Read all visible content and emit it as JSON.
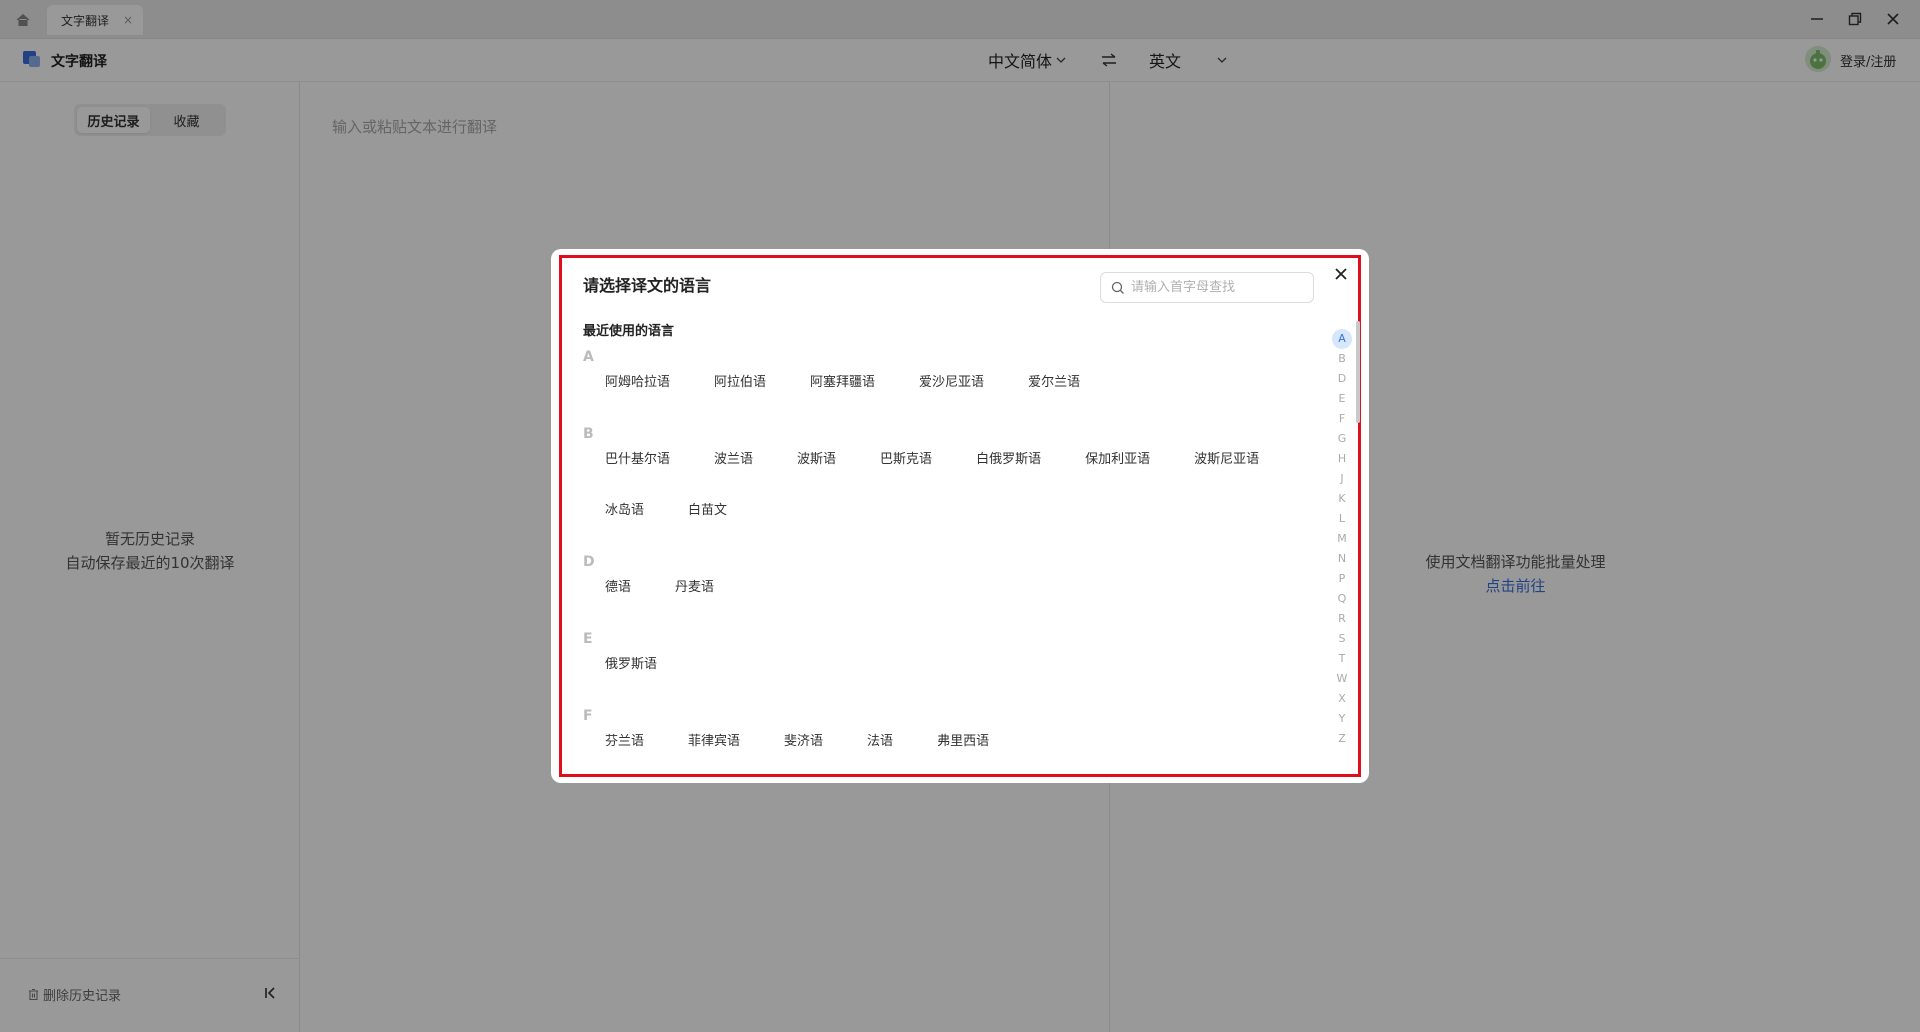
{
  "tabbar": {
    "tab_label": "文字翻译",
    "tab_close": "×"
  },
  "header": {
    "app_title": "文字翻译",
    "source_lang": "中文简体",
    "target_lang": "英文",
    "login_label": "登录/注册"
  },
  "history": {
    "tabs": [
      {
        "label": "历史记录",
        "active": true
      },
      {
        "label": "收藏",
        "active": false
      }
    ],
    "empty_line1": "暂无历史记录",
    "empty_line2": "自动保存最近的10次翻译",
    "delete_label": "删除历史记录"
  },
  "input": {
    "placeholder": "输入或粘贴文本进行翻译"
  },
  "output": {
    "tip": "使用文档翻译功能批量处理",
    "link": "点击前往"
  },
  "modal": {
    "title": "请选择译文的语言",
    "search_placeholder": "请输入首字母查找",
    "recent_title": "最近使用的语言",
    "groups": [
      {
        "letter": "A",
        "langs": [
          "阿姆哈拉语",
          "阿拉伯语",
          "阿塞拜疆语",
          "爱沙尼亚语",
          "爱尔兰语"
        ]
      },
      {
        "letter": "B",
        "langs": [
          "巴什基尔语",
          "波兰语",
          "波斯语",
          "巴斯克语",
          "白俄罗斯语",
          "保加利亚语",
          "波斯尼亚语",
          "冰岛语",
          "白苗文"
        ]
      },
      {
        "letter": "D",
        "langs": [
          "德语",
          "丹麦语"
        ]
      },
      {
        "letter": "E",
        "langs": [
          "俄罗斯语"
        ]
      },
      {
        "letter": "F",
        "langs": [
          "芬兰语",
          "菲律宾语",
          "斐济语",
          "法语",
          "弗里西语"
        ]
      }
    ],
    "alphabet": [
      "A",
      "B",
      "D",
      "E",
      "F",
      "G",
      "H",
      "J",
      "K",
      "L",
      "M",
      "N",
      "P",
      "Q",
      "R",
      "S",
      "T",
      "W",
      "X",
      "Y",
      "Z"
    ],
    "active_letter": "A"
  },
  "colors": {
    "accent": "#3a6fdc",
    "highlight_frame": "#e0101a"
  },
  "icons": {
    "home": "home-icon",
    "close": "close-icon",
    "minimize": "minimize-icon",
    "restore": "restore-icon",
    "swap": "swap-icon",
    "chevron": "chevron-down-icon",
    "search": "search-icon",
    "trash": "trash-icon",
    "collapse": "collapse-left-icon",
    "logo": "app-logo-icon"
  }
}
